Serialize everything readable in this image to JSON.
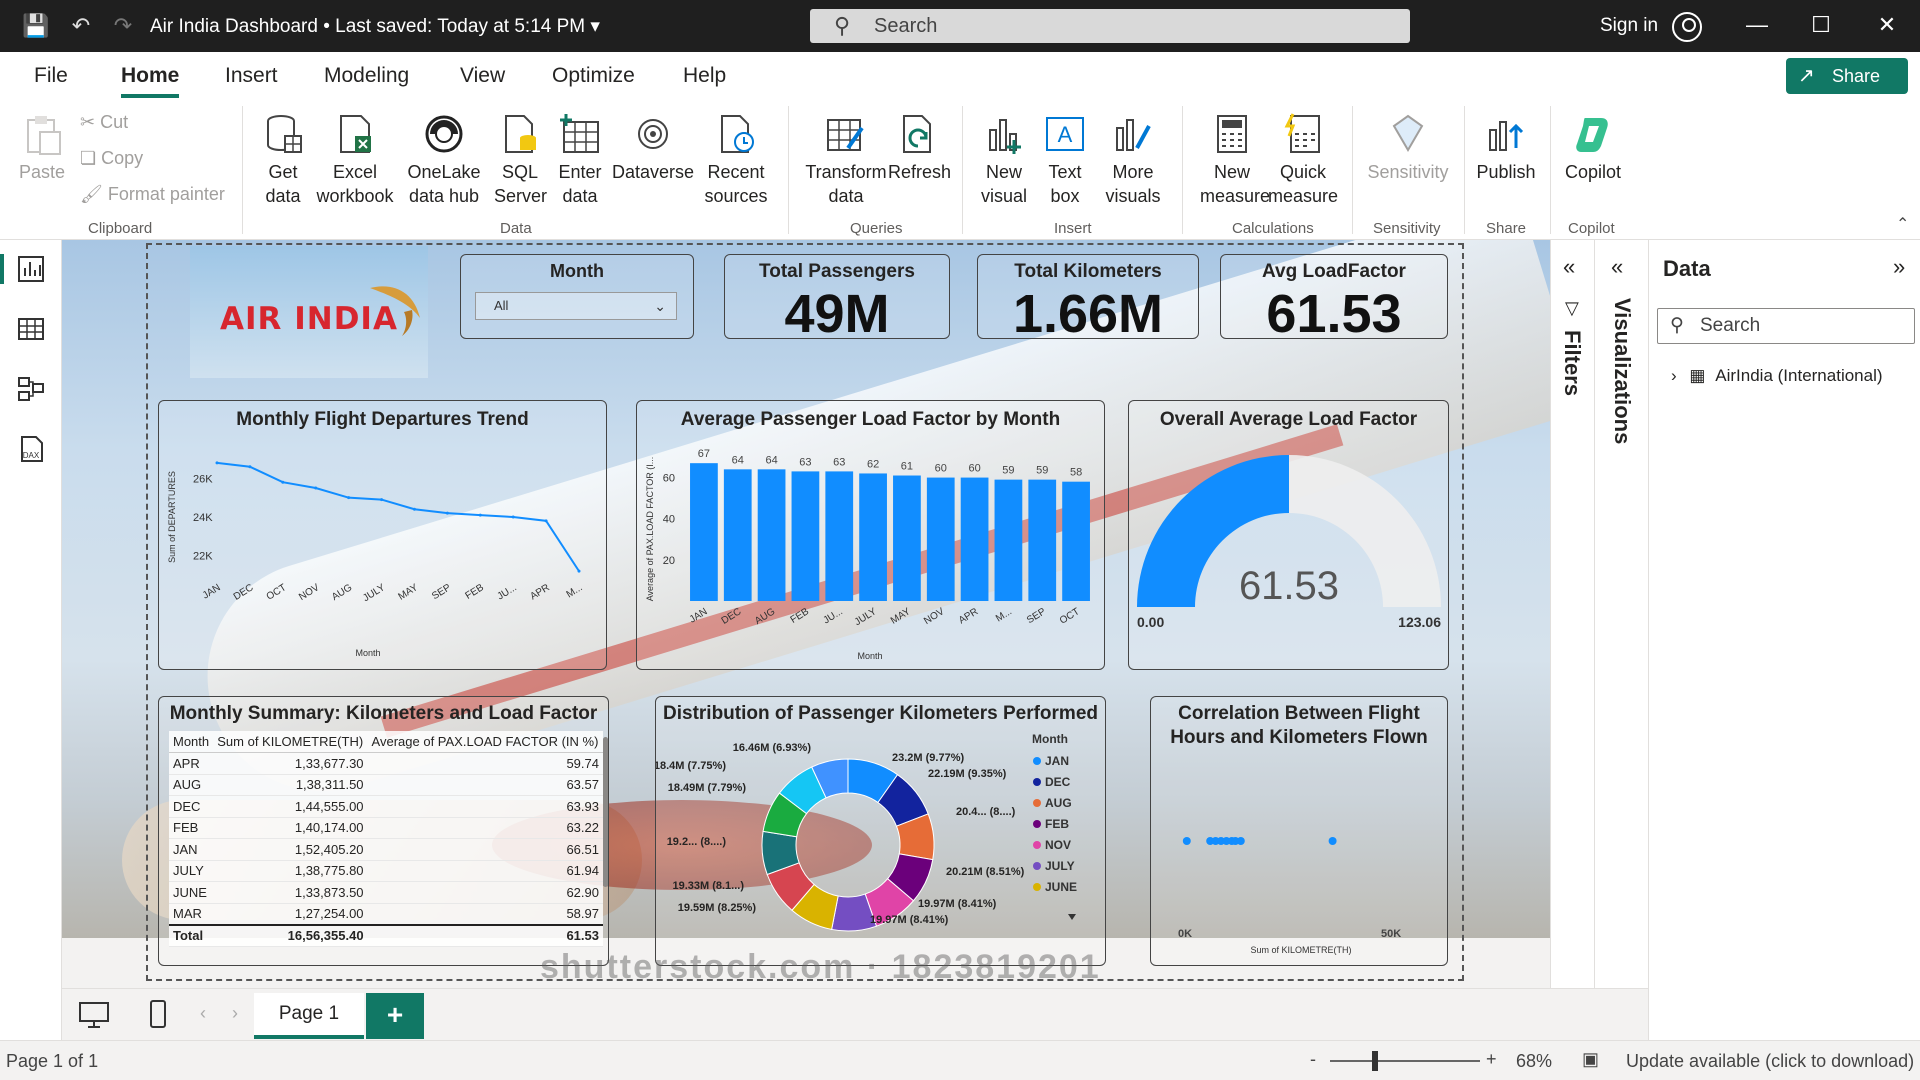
{
  "titlebar": {
    "doc_title": "Air India Dashboard • Last saved: Today at 5:14 PM",
    "search_placeholder": "Search",
    "signin": "Sign in"
  },
  "menu": {
    "items": [
      "File",
      "Home",
      "Insert",
      "Modeling",
      "View",
      "Optimize",
      "Help"
    ],
    "active": "Home",
    "share": "Share"
  },
  "ribbon": {
    "clipboard": {
      "paste": "Paste",
      "cut": "Cut",
      "copy": "Copy",
      "format_painter": "Format painter",
      "group": "Clipboard"
    },
    "data": {
      "get_data": "Get data",
      "excel": "Excel workbook",
      "onelake": "OneLake data hub",
      "sql": "SQL Server",
      "enter": "Enter data",
      "dataverse": "Dataverse",
      "recent": "Recent sources",
      "group": "Data"
    },
    "queries": {
      "transform": "Transform data",
      "refresh": "Refresh",
      "group": "Queries"
    },
    "insert": {
      "new_visual": "New visual",
      "text_box": "Text box",
      "more_visuals": "More visuals",
      "group": "Insert"
    },
    "calculations": {
      "new_measure": "New measure",
      "quick_measure": "Quick measure",
      "group": "Calculations"
    },
    "sensitivity": {
      "label": "Sensitivity",
      "group": "Sensitivity"
    },
    "share": {
      "publish": "Publish",
      "group": "Share"
    },
    "copilot": {
      "label": "Copilot",
      "group": "Copilot"
    }
  },
  "report": {
    "logo_text": "AIR INDIA",
    "slicer": {
      "title": "Month",
      "value": "All"
    },
    "kpis": [
      {
        "title": "Total Passengers",
        "value": "49M"
      },
      {
        "title": "Total Kilometers",
        "value": "1.66M"
      },
      {
        "title": "Avg LoadFactor",
        "value": "61.53"
      }
    ],
    "line_title": "Monthly Flight Departures Trend",
    "bar_title": "Average Passenger Load Factor by Month",
    "gauge_title": "Overall Average Load Factor",
    "table_title": "Monthly Summary: Kilometers and Load Factor",
    "donut_title": "Distribution of Passenger Kilometers Performed",
    "scatter_title_1": "Correlation Between Flight",
    "scatter_title_2": "Hours and Kilometers Flown",
    "watermark": "shutterstock.com · 1823819201"
  },
  "chart_data": [
    {
      "type": "line",
      "title": "Monthly Flight Departures Trend",
      "xlabel": "Month",
      "ylabel": "Sum of DEPARTURES",
      "categories": [
        "JAN",
        "DEC",
        "OCT",
        "NOV",
        "AUG",
        "JULY",
        "MAY",
        "SEP",
        "FEB",
        "JU...",
        "APR",
        "M..."
      ],
      "values": [
        26800,
        26600,
        25800,
        25500,
        25000,
        24900,
        24400,
        24200,
        24100,
        24000,
        23800,
        21200
      ],
      "yticks": [
        "26K",
        "24K",
        "22K"
      ],
      "ylim": [
        21000,
        27000
      ],
      "color": "#118dff"
    },
    {
      "type": "bar",
      "title": "Average Passenger Load Factor by Month",
      "xlabel": "Month",
      "ylabel": "Average of PAX.LOAD FACTOR (I...",
      "categories": [
        "JAN",
        "DEC",
        "AUG",
        "FEB",
        "JU...",
        "JULY",
        "MAY",
        "NOV",
        "APR",
        "M...",
        "SEP",
        "OCT"
      ],
      "values": [
        67,
        64,
        64,
        63,
        63,
        62,
        61,
        60,
        60,
        59,
        59,
        58
      ],
      "yticks": [
        "60",
        "40",
        "20",
        "0"
      ],
      "ylim": [
        0,
        70
      ],
      "color": "#118dff"
    },
    {
      "type": "gauge",
      "title": "Overall Average Load Factor",
      "value": 61.53,
      "min_label": "0.00",
      "max_label": "123.06",
      "min": 0,
      "max": 123.06,
      "value_label": "61.53",
      "color": "#118dff"
    },
    {
      "type": "table",
      "title": "Monthly Summary: Kilometers and Load Factor",
      "columns": [
        "Month",
        "Sum of KILOMETRE(TH)",
        "Average of PAX.LOAD FACTOR (IN %)"
      ],
      "rows": [
        [
          "APR",
          "1,33,677.30",
          "59.74"
        ],
        [
          "AUG",
          "1,38,311.50",
          "63.57"
        ],
        [
          "DEC",
          "1,44,555.00",
          "63.93"
        ],
        [
          "FEB",
          "1,40,174.00",
          "63.22"
        ],
        [
          "JAN",
          "1,52,405.20",
          "66.51"
        ],
        [
          "JULY",
          "1,38,775.80",
          "61.94"
        ],
        [
          "JUNE",
          "1,33,873.50",
          "62.90"
        ],
        [
          "MAR",
          "1,27,254.00",
          "58.97"
        ]
      ],
      "total": [
        "Total",
        "16,56,355.40",
        "61.53"
      ]
    },
    {
      "type": "pie",
      "title": "Distribution of Passenger Kilometers Performed",
      "legend_title": "Month",
      "legend": [
        "JAN",
        "DEC",
        "AUG",
        "FEB",
        "NOV",
        "JULY",
        "JUNE"
      ],
      "slices": [
        {
          "label": "23.2M (9.77%)",
          "value": 9.77,
          "color": "#118dff"
        },
        {
          "label": "22.19M (9.35%)",
          "value": 9.35,
          "color": "#12239e"
        },
        {
          "label": "20.4... (8....)",
          "value": 8.6,
          "color": "#e66c37"
        },
        {
          "label": "20.21M (8.51%)",
          "value": 8.51,
          "color": "#6b007b"
        },
        {
          "label": "19.97M (8.41%)",
          "value": 8.41,
          "color": "#e044a7"
        },
        {
          "label": "19.97M (8.41%)",
          "value": 8.41,
          "color": "#744ec2"
        },
        {
          "label": "19.59M (8.25%)",
          "value": 8.25,
          "color": "#d9b300"
        },
        {
          "label": "19.33M (8.1...)",
          "value": 8.14,
          "color": "#d64550"
        },
        {
          "label": "19.2... (8....)",
          "value": 8.1,
          "color": "#197278"
        },
        {
          "label": "18.49M (7.79%)",
          "value": 7.79,
          "color": "#1aab40"
        },
        {
          "label": "18.4M (7.75%)",
          "value": 7.75,
          "color": "#15c6f4"
        },
        {
          "label": "16.46M (6.93%)",
          "value": 6.93,
          "color": "#4092ff"
        }
      ],
      "legend_colors": [
        "#118dff",
        "#12239e",
        "#e66c37",
        "#6b007b",
        "#e044a7",
        "#744ec2",
        "#d9b300"
      ]
    },
    {
      "type": "scatter",
      "title": "Correlation Between Flight Hours and Kilometers Flown",
      "xlabel": "Sum of KILOMETRE(TH)",
      "xticks": [
        "0K",
        "50K"
      ],
      "xlim": [
        0,
        60000
      ],
      "points": [
        [
          500,
          0
        ],
        [
          7000,
          0
        ],
        [
          8500,
          0
        ],
        [
          10000,
          0
        ],
        [
          11500,
          0
        ],
        [
          13000,
          0
        ],
        [
          14000,
          0
        ],
        [
          15500,
          0
        ],
        [
          41000,
          0
        ]
      ],
      "color": "#118dff"
    }
  ],
  "panes": {
    "filters": "Filters",
    "visualizations": "Visualizations",
    "data_title": "Data",
    "data_search": "Search",
    "table_item": "AirIndia (International)"
  },
  "pages": {
    "tab": "Page 1",
    "add": "+"
  },
  "status": {
    "page_info": "Page 1 of 1",
    "zoom": "68%",
    "update": "Update available (click to download)"
  }
}
